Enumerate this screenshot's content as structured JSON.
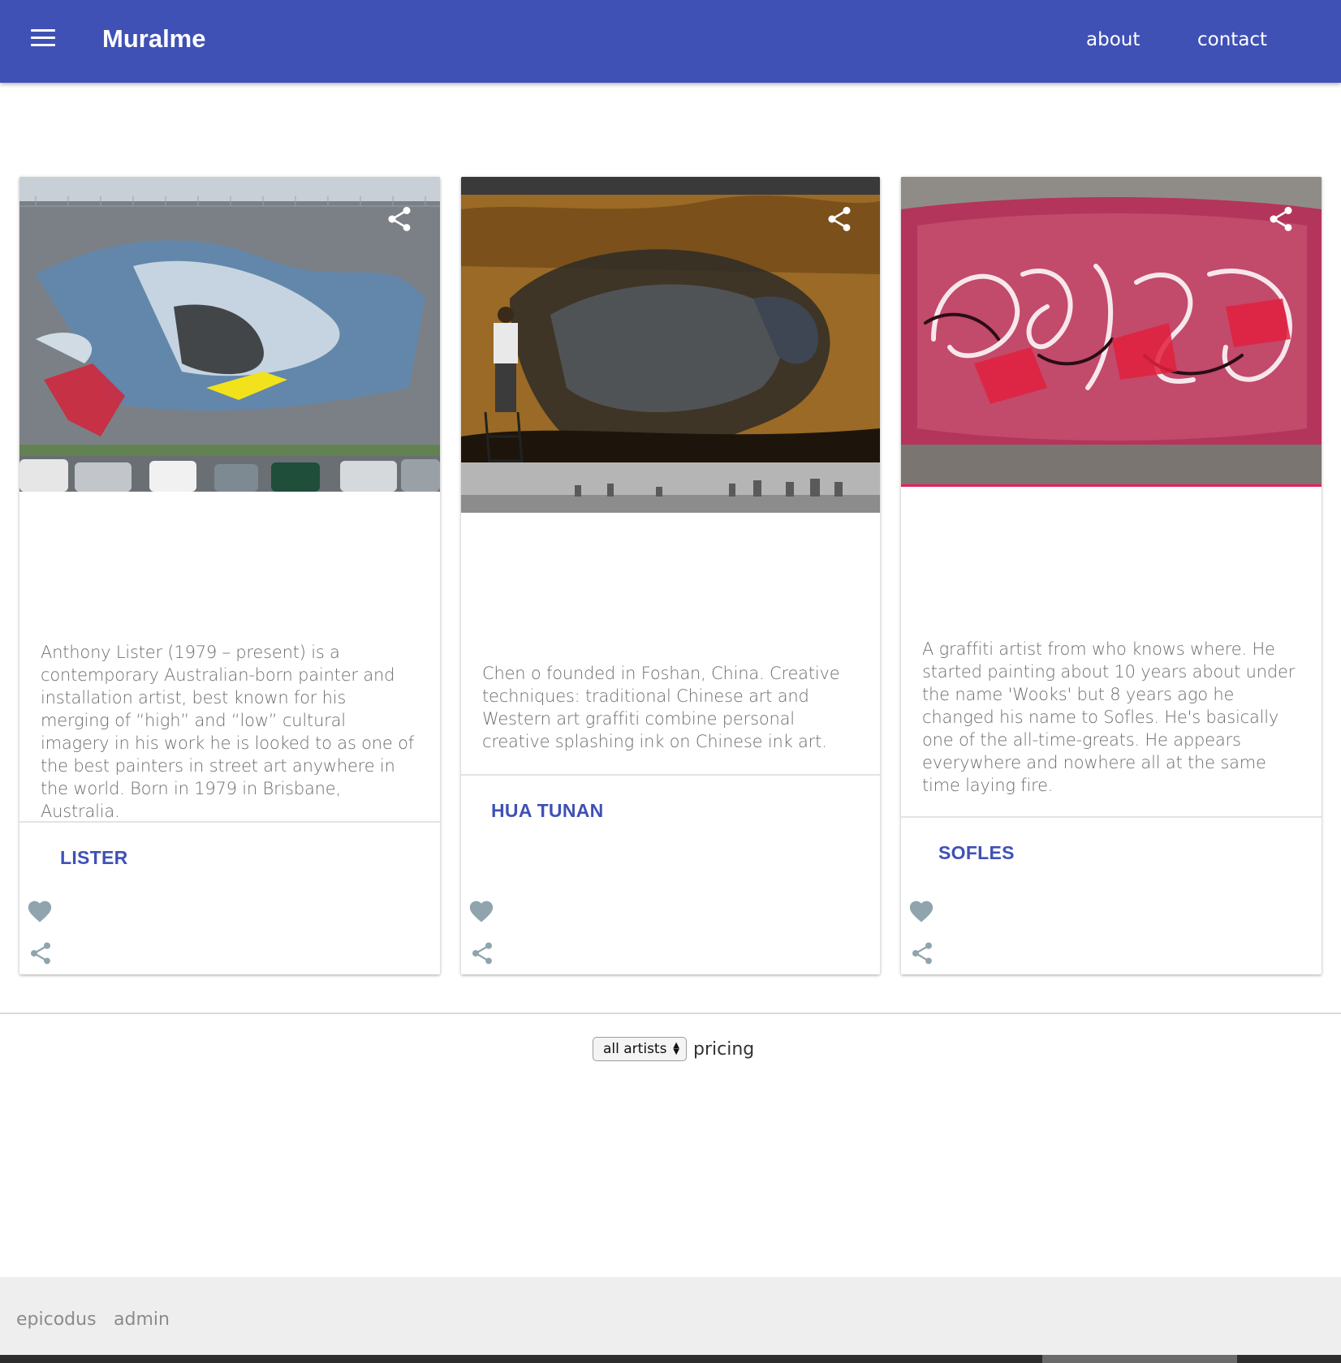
{
  "header": {
    "brand": "Muralme",
    "nav": {
      "about": "about",
      "contact": "contact"
    },
    "bg_color": "#3f51b5"
  },
  "cards": [
    {
      "action_label": "LISTER",
      "description": "Anthony Lister (1979 – present) is a contemporary Australian-born painter and installation artist, best known for his merging of “high” and “low” cultural imagery in his work he is looked to as one of the best painters in street art anywhere in the world. Born in 1979 in Brisbane, Australia."
    },
    {
      "action_label": "HUA TUNAN",
      "description": "Chen o founded in Foshan, China. Creative techniques: traditional Chinese art and Western art graffiti combine personal creative splashing ink on Chinese ink art."
    },
    {
      "action_label": "SOFLES",
      "description": "A graffiti artist from who knows where. He started painting about 10 years about under the name 'Wooks' but 8 years ago he changed his name to Sofles. He's basically one of the all-time-greats. He appears everywhere and nowhere all at the same time laying fire."
    }
  ],
  "filter": {
    "selected": "all artists",
    "label": "pricing"
  },
  "footer": {
    "links": [
      "epicodus",
      "admin"
    ]
  },
  "colors": {
    "accent": "#3f51b5",
    "icon_gray": "#90a4ae",
    "media_border": "#e91e63"
  },
  "icons": {
    "menu": "hamburger-menu-icon",
    "media_share": "share-icon",
    "favorite": "heart-icon",
    "share": "share-icon"
  }
}
